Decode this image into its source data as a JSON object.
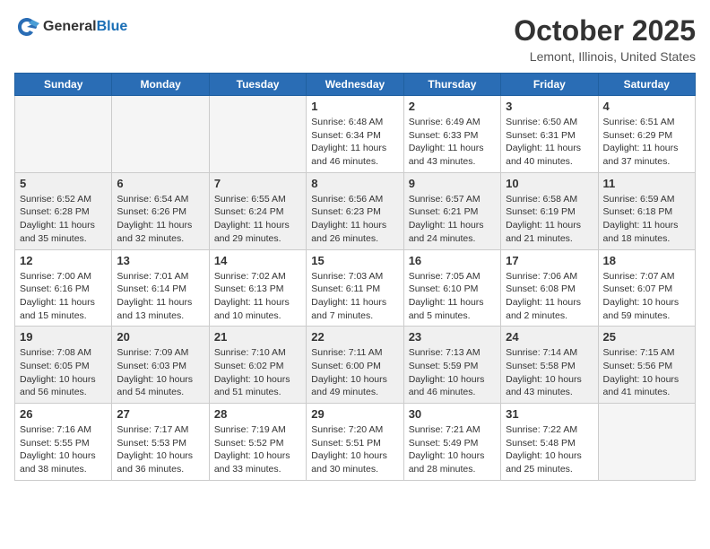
{
  "logo": {
    "general": "General",
    "blue": "Blue"
  },
  "header": {
    "month": "October 2025",
    "location": "Lemont, Illinois, United States"
  },
  "weekdays": [
    "Sunday",
    "Monday",
    "Tuesday",
    "Wednesday",
    "Thursday",
    "Friday",
    "Saturday"
  ],
  "weeks": [
    [
      {
        "day": "",
        "empty": true
      },
      {
        "day": "",
        "empty": true
      },
      {
        "day": "",
        "empty": true
      },
      {
        "day": "1",
        "sunrise": "6:48 AM",
        "sunset": "6:34 PM",
        "daylight": "11 hours and 46 minutes."
      },
      {
        "day": "2",
        "sunrise": "6:49 AM",
        "sunset": "6:33 PM",
        "daylight": "11 hours and 43 minutes."
      },
      {
        "day": "3",
        "sunrise": "6:50 AM",
        "sunset": "6:31 PM",
        "daylight": "11 hours and 40 minutes."
      },
      {
        "day": "4",
        "sunrise": "6:51 AM",
        "sunset": "6:29 PM",
        "daylight": "11 hours and 37 minutes."
      }
    ],
    [
      {
        "day": "5",
        "sunrise": "6:52 AM",
        "sunset": "6:28 PM",
        "daylight": "11 hours and 35 minutes."
      },
      {
        "day": "6",
        "sunrise": "6:54 AM",
        "sunset": "6:26 PM",
        "daylight": "11 hours and 32 minutes."
      },
      {
        "day": "7",
        "sunrise": "6:55 AM",
        "sunset": "6:24 PM",
        "daylight": "11 hours and 29 minutes."
      },
      {
        "day": "8",
        "sunrise": "6:56 AM",
        "sunset": "6:23 PM",
        "daylight": "11 hours and 26 minutes."
      },
      {
        "day": "9",
        "sunrise": "6:57 AM",
        "sunset": "6:21 PM",
        "daylight": "11 hours and 24 minutes."
      },
      {
        "day": "10",
        "sunrise": "6:58 AM",
        "sunset": "6:19 PM",
        "daylight": "11 hours and 21 minutes."
      },
      {
        "day": "11",
        "sunrise": "6:59 AM",
        "sunset": "6:18 PM",
        "daylight": "11 hours and 18 minutes."
      }
    ],
    [
      {
        "day": "12",
        "sunrise": "7:00 AM",
        "sunset": "6:16 PM",
        "daylight": "11 hours and 15 minutes."
      },
      {
        "day": "13",
        "sunrise": "7:01 AM",
        "sunset": "6:14 PM",
        "daylight": "11 hours and 13 minutes."
      },
      {
        "day": "14",
        "sunrise": "7:02 AM",
        "sunset": "6:13 PM",
        "daylight": "11 hours and 10 minutes."
      },
      {
        "day": "15",
        "sunrise": "7:03 AM",
        "sunset": "6:11 PM",
        "daylight": "11 hours and 7 minutes."
      },
      {
        "day": "16",
        "sunrise": "7:05 AM",
        "sunset": "6:10 PM",
        "daylight": "11 hours and 5 minutes."
      },
      {
        "day": "17",
        "sunrise": "7:06 AM",
        "sunset": "6:08 PM",
        "daylight": "11 hours and 2 minutes."
      },
      {
        "day": "18",
        "sunrise": "7:07 AM",
        "sunset": "6:07 PM",
        "daylight": "10 hours and 59 minutes."
      }
    ],
    [
      {
        "day": "19",
        "sunrise": "7:08 AM",
        "sunset": "6:05 PM",
        "daylight": "10 hours and 56 minutes."
      },
      {
        "day": "20",
        "sunrise": "7:09 AM",
        "sunset": "6:03 PM",
        "daylight": "10 hours and 54 minutes."
      },
      {
        "day": "21",
        "sunrise": "7:10 AM",
        "sunset": "6:02 PM",
        "daylight": "10 hours and 51 minutes."
      },
      {
        "day": "22",
        "sunrise": "7:11 AM",
        "sunset": "6:00 PM",
        "daylight": "10 hours and 49 minutes."
      },
      {
        "day": "23",
        "sunrise": "7:13 AM",
        "sunset": "5:59 PM",
        "daylight": "10 hours and 46 minutes."
      },
      {
        "day": "24",
        "sunrise": "7:14 AM",
        "sunset": "5:58 PM",
        "daylight": "10 hours and 43 minutes."
      },
      {
        "day": "25",
        "sunrise": "7:15 AM",
        "sunset": "5:56 PM",
        "daylight": "10 hours and 41 minutes."
      }
    ],
    [
      {
        "day": "26",
        "sunrise": "7:16 AM",
        "sunset": "5:55 PM",
        "daylight": "10 hours and 38 minutes."
      },
      {
        "day": "27",
        "sunrise": "7:17 AM",
        "sunset": "5:53 PM",
        "daylight": "10 hours and 36 minutes."
      },
      {
        "day": "28",
        "sunrise": "7:19 AM",
        "sunset": "5:52 PM",
        "daylight": "10 hours and 33 minutes."
      },
      {
        "day": "29",
        "sunrise": "7:20 AM",
        "sunset": "5:51 PM",
        "daylight": "10 hours and 30 minutes."
      },
      {
        "day": "30",
        "sunrise": "7:21 AM",
        "sunset": "5:49 PM",
        "daylight": "10 hours and 28 minutes."
      },
      {
        "day": "31",
        "sunrise": "7:22 AM",
        "sunset": "5:48 PM",
        "daylight": "10 hours and 25 minutes."
      },
      {
        "day": "",
        "empty": true
      }
    ]
  ],
  "labels": {
    "sunrise": "Sunrise:",
    "sunset": "Sunset:",
    "daylight": "Daylight:"
  }
}
